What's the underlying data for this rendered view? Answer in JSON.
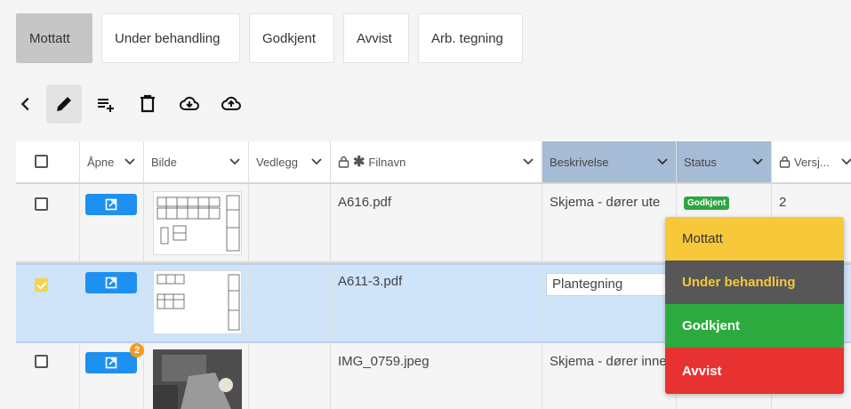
{
  "tabs": [
    {
      "label": "Mottatt",
      "active": true
    },
    {
      "label": "Under behandling",
      "active": false
    },
    {
      "label": "Godkjent",
      "active": false
    },
    {
      "label": "Avvist",
      "active": false
    },
    {
      "label": "Arb. tegning",
      "active": false
    }
  ],
  "toolbar": {
    "back_icon": "chevron-left-icon",
    "edit_icon": "pencil-icon",
    "add_row_icon": "playlist-add-icon",
    "delete_icon": "trash-icon",
    "download_icon": "cloud-download-icon",
    "upload_icon": "cloud-upload-icon"
  },
  "columns": {
    "open": "Åpne",
    "image": "Bilde",
    "attachment": "Vedlegg",
    "filename": "Filnavn",
    "description": "Beskrivelse",
    "status": "Status",
    "version": "Versj..."
  },
  "rows": [
    {
      "filename": "A616.pdf",
      "description": "Skjema - dører ute",
      "status": "Godkjent",
      "version": "2",
      "checked": false
    },
    {
      "filename": "A611-3.pdf",
      "description": "Plantegning",
      "status": "",
      "version": "",
      "checked": true
    },
    {
      "filename": "IMG_0759.jpeg",
      "description": "Skjema - dører inne",
      "status": "",
      "version": "",
      "checked": false,
      "badge": "2"
    }
  ],
  "status_menu": [
    {
      "label": "Mottatt",
      "bg": "#f6c83a",
      "fg": "#333333"
    },
    {
      "label": "Under behandling",
      "bg": "#575757",
      "fg": "#f6c83a"
    },
    {
      "label": "Godkjent",
      "bg": "#2caa3e",
      "fg": "#ffffff"
    },
    {
      "label": "Avvist",
      "bg": "#e83232",
      "fg": "#ffffff"
    }
  ],
  "colors": {
    "accent": "#1e90f0",
    "selected_row": "#cfe3f9",
    "header_highlight": "#a6bcd6"
  }
}
